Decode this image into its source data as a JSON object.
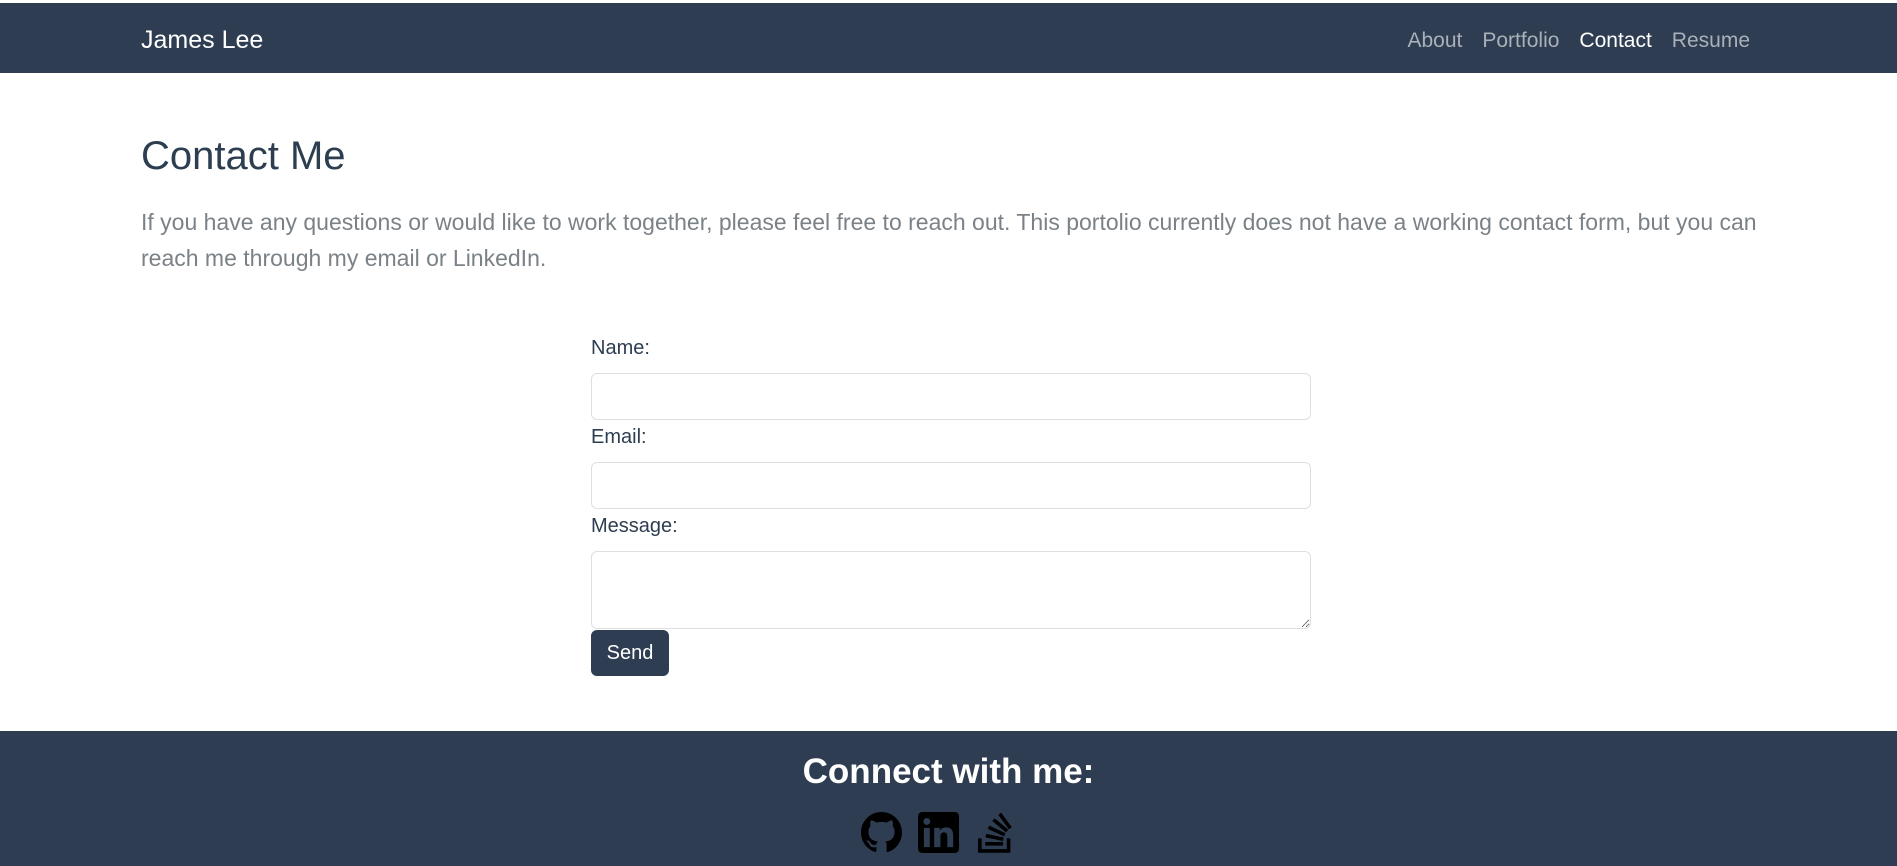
{
  "navbar": {
    "brand": "James Lee",
    "links": [
      {
        "label": "About",
        "active": false
      },
      {
        "label": "Portfolio",
        "active": false
      },
      {
        "label": "Contact",
        "active": true
      },
      {
        "label": "Resume",
        "active": false
      }
    ]
  },
  "main": {
    "title": "Contact Me",
    "intro": "If you have any questions or would like to work together, please feel free to reach out. This portolio currently does not have a working contact form, but you can reach me through my email or LinkedIn."
  },
  "form": {
    "name_label": "Name:",
    "name_value": "",
    "email_label": "Email:",
    "email_value": "",
    "message_label": "Message:",
    "message_value": "",
    "send_label": "Send"
  },
  "footer": {
    "title": "Connect with me:",
    "icons": [
      "github-icon",
      "linkedin-icon",
      "stackoverflow-icon"
    ]
  },
  "colors": {
    "nav_bg": "#2e3d51",
    "heading": "#2c3e50",
    "muted_text": "#7b8287",
    "nav_link": "#a9b0b8"
  }
}
